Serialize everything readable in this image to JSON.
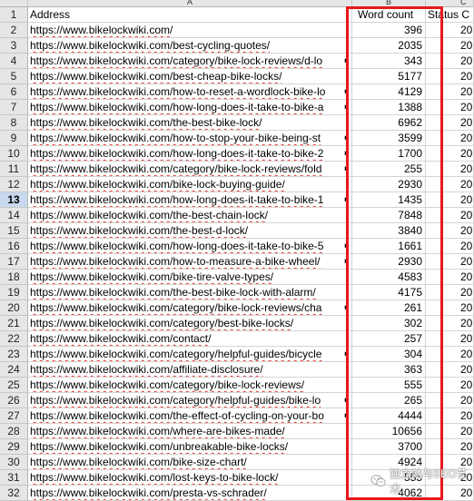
{
  "columns": {
    "a": "A",
    "b": "B",
    "c": "C"
  },
  "header_row": {
    "num": "1",
    "address": "Address",
    "word_count": "Word count",
    "status": "Status C"
  },
  "active_row": "13",
  "rows": [
    {
      "num": "2",
      "url": "https://www.bikelockwiki.com/",
      "count": "396",
      "status": "20",
      "overflow": false
    },
    {
      "num": "3",
      "url": "https://www.bikelockwiki.com/best-cycling-quotes/",
      "count": "2035",
      "status": "20",
      "overflow": false
    },
    {
      "num": "4",
      "url": "https://www.bikelockwiki.com/category/bike-lock-reviews/d-lo",
      "count": "343",
      "status": "20",
      "overflow": true
    },
    {
      "num": "5",
      "url": "https://www.bikelockwiki.com/best-cheap-bike-locks/",
      "count": "5177",
      "status": "20",
      "overflow": false
    },
    {
      "num": "6",
      "url": "https://www.bikelockwiki.com/how-to-reset-a-wordlock-bike-lo",
      "count": "4129",
      "status": "20",
      "overflow": true
    },
    {
      "num": "7",
      "url": "https://www.bikelockwiki.com/how-long-does-it-take-to-bike-a",
      "count": "1388",
      "status": "20",
      "overflow": true
    },
    {
      "num": "8",
      "url": "https://www.bikelockwiki.com/the-best-bike-lock/",
      "count": "6962",
      "status": "20",
      "overflow": false
    },
    {
      "num": "9",
      "url": "https://www.bikelockwiki.com/how-to-stop-your-bike-being-st",
      "count": "3599",
      "status": "20",
      "overflow": true
    },
    {
      "num": "10",
      "url": "https://www.bikelockwiki.com/how-long-does-it-take-to-bike-2",
      "count": "1700",
      "status": "20",
      "overflow": true
    },
    {
      "num": "11",
      "url": "https://www.bikelockwiki.com/category/bike-lock-reviews/fold",
      "count": "255",
      "status": "20",
      "overflow": true
    },
    {
      "num": "12",
      "url": "https://www.bikelockwiki.com/bike-lock-buying-guide/",
      "count": "2930",
      "status": "20",
      "overflow": false
    },
    {
      "num": "13",
      "url": "https://www.bikelockwiki.com/how-long-does-it-take-to-bike-1",
      "count": "1435",
      "status": "20",
      "overflow": true
    },
    {
      "num": "14",
      "url": "https://www.bikelockwiki.com/the-best-chain-lock/",
      "count": "7848",
      "status": "20",
      "overflow": false
    },
    {
      "num": "15",
      "url": "https://www.bikelockwiki.com/the-best-d-lock/",
      "count": "3840",
      "status": "20",
      "overflow": false
    },
    {
      "num": "16",
      "url": "https://www.bikelockwiki.com/how-long-does-it-take-to-bike-5",
      "count": "1661",
      "status": "20",
      "overflow": true
    },
    {
      "num": "17",
      "url": "https://www.bikelockwiki.com/how-to-measure-a-bike-wheel/",
      "count": "2930",
      "status": "20",
      "overflow": true
    },
    {
      "num": "18",
      "url": "https://www.bikelockwiki.com/bike-tire-valve-types/",
      "count": "4583",
      "status": "20",
      "overflow": false
    },
    {
      "num": "19",
      "url": "https://www.bikelockwiki.com/the-best-bike-lock-with-alarm/",
      "count": "4175",
      "status": "20",
      "overflow": false
    },
    {
      "num": "20",
      "url": "https://www.bikelockwiki.com/category/bike-lock-reviews/cha",
      "count": "261",
      "status": "20",
      "overflow": true
    },
    {
      "num": "21",
      "url": "https://www.bikelockwiki.com/category/best-bike-locks/",
      "count": "302",
      "status": "20",
      "overflow": false
    },
    {
      "num": "22",
      "url": "https://www.bikelockwiki.com/contact/",
      "count": "257",
      "status": "20",
      "overflow": false
    },
    {
      "num": "23",
      "url": "https://www.bikelockwiki.com/category/helpful-guides/bicycle",
      "count": "304",
      "status": "20",
      "overflow": true
    },
    {
      "num": "24",
      "url": "https://www.bikelockwiki.com/affiliate-disclosure/",
      "count": "363",
      "status": "20",
      "overflow": false
    },
    {
      "num": "25",
      "url": "https://www.bikelockwiki.com/category/bike-lock-reviews/",
      "count": "555",
      "status": "20",
      "overflow": false
    },
    {
      "num": "26",
      "url": "https://www.bikelockwiki.com/category/helpful-guides/bike-lo",
      "count": "265",
      "status": "20",
      "overflow": true
    },
    {
      "num": "27",
      "url": "https://www.bikelockwiki.com/the-effect-of-cycling-on-your-bo",
      "count": "4444",
      "status": "20",
      "overflow": true
    },
    {
      "num": "28",
      "url": "https://www.bikelockwiki.com/where-are-bikes-made/",
      "count": "10656",
      "status": "20",
      "overflow": false
    },
    {
      "num": "29",
      "url": "https://www.bikelockwiki.com/unbreakable-bike-locks/",
      "count": "3700",
      "status": "20",
      "overflow": false
    },
    {
      "num": "30",
      "url": "https://www.bikelockwiki.com/bike-size-chart/",
      "count": "4924",
      "status": "20",
      "overflow": false
    },
    {
      "num": "31",
      "url": "https://www.bikelockwiki.com/lost-keys-to-bike-lock/",
      "count": "555",
      "status": "20",
      "overflow": false
    },
    {
      "num": "32",
      "url": "https://www.bikelockwiki.com/presta-vs-schrader/",
      "count": "4062",
      "status": "20",
      "overflow": false
    }
  ],
  "watermark": {
    "text": "独立站与SEO艺术",
    "icon": "wechat-icon"
  },
  "colors": {
    "highlight": "#e8181b",
    "spellcheck": "#e53935",
    "active_row": "#c8d9ef"
  }
}
